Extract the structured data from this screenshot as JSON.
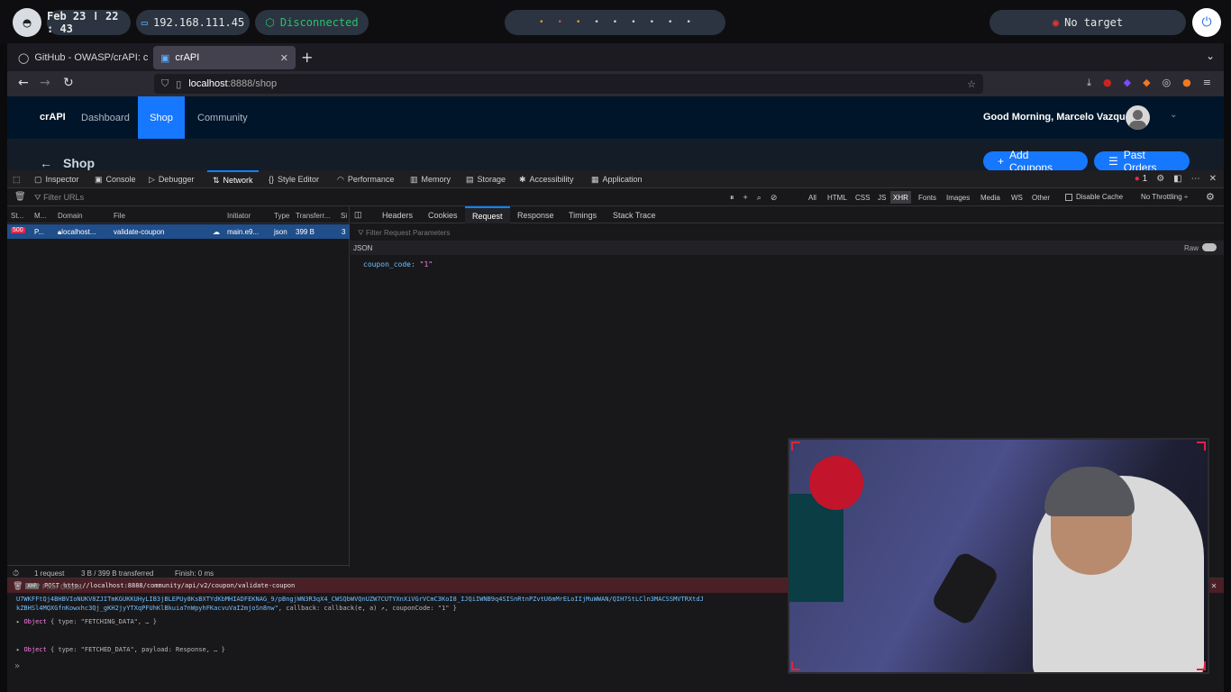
{
  "system_bar": {
    "clock": "Feb 23 ǀ 22 : 43",
    "ip": "192.168.111.45",
    "vpn_status": "Disconnected",
    "target": "No target",
    "workspaces": [
      "•",
      "•",
      "•",
      "•",
      "•",
      "•",
      "•",
      "•",
      "•"
    ]
  },
  "browser": {
    "tabs": [
      {
        "label": "GitHub - OWASP/crAPI: co"
      },
      {
        "label": "crAPI"
      }
    ],
    "url": {
      "host": "localhost",
      "rest": ":8888/shop"
    }
  },
  "app": {
    "brand": "crAPI",
    "nav": {
      "dashboard": "Dashboard",
      "shop": "Shop",
      "community": "Community"
    },
    "greeting": "Good Morning, Marcelo Vazquez!",
    "page_title": "Shop",
    "add_coupons": "Add Coupons",
    "past_orders": "Past Orders"
  },
  "devtools": {
    "tabs": {
      "inspector": "Inspector",
      "console": "Console",
      "debugger": "Debugger",
      "network": "Network",
      "style_editor": "Style Editor",
      "performance": "Performance",
      "memory": "Memory",
      "storage": "Storage",
      "accessibility": "Accessibility",
      "application": "Application"
    },
    "error_count": "1",
    "filter_urls_placeholder": "Filter URLs",
    "filter_types": [
      "All",
      "HTML",
      "CSS",
      "JS",
      "XHR",
      "Fonts",
      "Images",
      "Media",
      "WS",
      "Other"
    ],
    "disable_cache": "Disable Cache",
    "throttling": "No Throttling ÷",
    "columns": [
      "St...",
      "M...",
      "Domain",
      "File",
      "Initiator",
      "Type",
      "Transferr...",
      "Si"
    ],
    "request": {
      "status": "500",
      "method": "P...",
      "domain": "localhost...",
      "file": "validate-coupon",
      "initiator": "main.e9...",
      "type": "json",
      "transferred": "399 B",
      "size": "3"
    },
    "footer": {
      "requests": "1 request",
      "transferred": "3 B / 399 B transferred",
      "finish": "Finish: 0 ms"
    },
    "detail_tabs": {
      "headers": "Headers",
      "cookies": "Cookies",
      "request": "Request",
      "response": "Response",
      "timings": "Timings",
      "stack_trace": "Stack Trace"
    },
    "filter_params_placeholder": "Filter Request Parameters",
    "json_label": "JSON",
    "raw_label": "Raw",
    "payload": {
      "key": "coupon_code:",
      "value": "\"1\""
    },
    "console": {
      "filter_placeholder": "Filter Output",
      "line1": "U7WKFFtQj4BHBVIoNUKV8ZJITmKGUKKUHyLIB3jBLEPUy8KsBXTYdKbMHIADFEKNAG_9/pBngjWN3R3qX4_CWSQbWVQnUZW7CUTYXnXiVGrVCmC3KoI8_IJQiIWNB9q4SISnRtnPZvtU6mMrELoIIjMuWWAN/QIH7StLCln3MACSSMVTRXtdJ",
      "line2_text": "kZBHSl4MQXGfnKowxhc3Qj_gKH2jyYTXqPFUhKlBkuia7nWpyhFKacvuVaI2mjoSn8nw\", ",
      "line2_tail": "callback: callback(e, a) ↗, couponCode: \"1\" }",
      "line3_obj": "Object",
      "line3_rest": "{ type: \"FETCHING_DATA\", … }",
      "xhr_badge": "XHR",
      "xhr_line": "POST http://localhost:8888/community/api/v2/coupon/validate-coupon",
      "line5_obj": "Object",
      "line5_rest": "{ type: \"FETCHED_DATA\", payload: Response, … }",
      "prompt": "»"
    }
  },
  "colors": {
    "accent": "#0a84ff",
    "shop_active": "#1677ff",
    "vpn": "#29c26e",
    "error": "#e22850"
  }
}
